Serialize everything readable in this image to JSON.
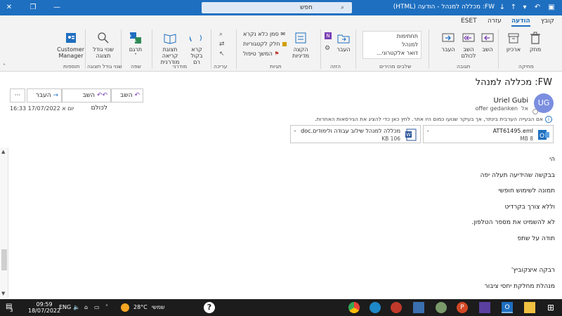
{
  "window": {
    "title": "FW: מכללה למנהל - הודעה (HTML)",
    "search_placeholder": "חפש"
  },
  "tabs": [
    {
      "label": "קובץ",
      "active": false
    },
    {
      "label": "הודעה",
      "active": true
    },
    {
      "label": "עזרה",
      "active": false
    },
    {
      "label": "ESET",
      "active": false
    }
  ],
  "ribbon": {
    "delete_group": {
      "archive": "ארכיון",
      "delete": "מחק",
      "label": "מחיקה"
    },
    "respond_group": {
      "reply": "השב",
      "reply_all": "השב לכולם",
      "forward": "העבר",
      "label": "תגובה"
    },
    "quicksteps_group": {
      "items": [
        "תחתימות",
        "למנהל",
        "דואר אלקטרוני..."
      ],
      "label": "שלבים מהירים"
    },
    "move_group": {
      "move": "העבר",
      "label": "הזזה"
    },
    "tags_group": {
      "policy": "הקצה מדיניות",
      "unread": "סמן כלא נקרא",
      "categorize": "חלק לקטגוריות",
      "followup": "המשך טיפול",
      "label": "תגיות"
    },
    "editing_group": {
      "label": "עריכה"
    },
    "immersive_group": {
      "read_aloud": "קרא בקול רם",
      "immersive": "תצוגת קריאה מודרנית",
      "label": "מודרני"
    },
    "language_group": {
      "translate": "תרגם",
      "label": "שפה"
    },
    "zoom_group": {
      "zoom": "שנוי גודל תצוגה",
      "label": "שנוי גודל תצוגה"
    },
    "addin_group": {
      "customer_manager": "Customer Manager",
      "label": "תוספות"
    }
  },
  "message": {
    "subject": "FW: מכללה למנהל",
    "actions": {
      "reply": "השב",
      "reply_all": "השב לכולם",
      "forward": "העבר",
      "more": "···"
    },
    "avatar_initials": "UG",
    "sender": "Uriel Gubi",
    "to_label": "אל",
    "to": "offer gedanken",
    "date": "יום א 17/07/2022 16:33",
    "info": "אם הבעייה הערבית בינתר, אך בעיקר שנועו כמום היו אתר. לחץ כאן כדי להציג את הגירסאות האחרות.",
    "attachments": [
      {
        "name": "ATT61495.eml",
        "size": "8 MB",
        "type": "outlook"
      },
      {
        "name": "מכללה למנהל שילוב עבודה ולימודים.doc",
        "size": "106 KB",
        "type": "word"
      }
    ],
    "body": [
      "הי",
      "בבקשה שהידיעה תעלה יפה",
      "תמונה לשימוש חופשי",
      "וללא צורך בקרדיט",
      "לא להשמיט את מספר הטלפון.",
      "תודה על שתפ",
      "",
      "רבקה איצקוביץ'",
      "מנהלת מחלקת יחסי ציבור"
    ]
  },
  "taskbar": {
    "weather_temp": "28°C",
    "weather_desc": "שמשי",
    "lang": "ENG",
    "time": "09:59",
    "date": "18/07/2022",
    "notifications": "3"
  },
  "colors": {
    "accent": "#1e6fc0",
    "avatar": "#7b8ee0",
    "ribbon_bg": "#f3f3f3",
    "taskbar": "#1c1c1c"
  }
}
